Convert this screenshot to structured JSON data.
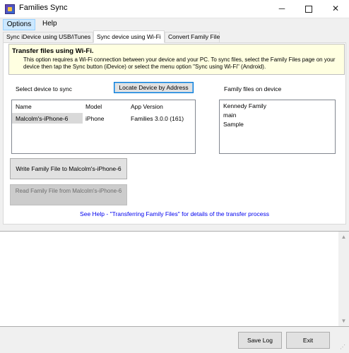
{
  "window": {
    "title": "Families Sync",
    "controls": {
      "minimize": "─",
      "close": "✕"
    }
  },
  "menu": {
    "items": [
      "Options",
      "Help"
    ]
  },
  "tabs": [
    {
      "label": "Sync iDevice using USB/iTunes",
      "active": false
    },
    {
      "label": "Sync device using Wi-Fi",
      "active": true
    },
    {
      "label": "Convert Family File",
      "active": false
    }
  ],
  "info": {
    "title": "Transfer files using Wi-Fi.",
    "text": "This option requires a Wi-Fi connection between your device and your PC.  To sync files, select the Family Files page on your device then tap the Sync button (iDevice) or select the menu option \"Sync using Wi-Fi\" (Android)."
  },
  "device_section": {
    "label": "Select device to sync",
    "locate_button": "Locate Device by Address",
    "columns": [
      "Name",
      "Model",
      "App Version"
    ],
    "rows": [
      {
        "name": "Malcolm's-iPhone-6",
        "model": "iPhone",
        "version": "Families 3.0.0 (161)"
      }
    ]
  },
  "family_files": {
    "label": "Family files on device",
    "items": [
      "Kennedy Family",
      "main",
      "Sample"
    ]
  },
  "actions": {
    "write_button": "Write Family File to Malcolm's-iPhone-6",
    "read_button": "Read Family File from Malcolm's-iPhone-6"
  },
  "help_link": "See Help - \"Transferring Family Files\" for details of the transfer process",
  "bottom": {
    "save_log": "Save Log",
    "exit": "Exit"
  },
  "scroll_arrows": {
    "up": "▲",
    "down": "▼"
  },
  "colors": {
    "info_bg": "#ffffe1",
    "selected_menu": "#cce8ff",
    "link": "#0000ee"
  }
}
